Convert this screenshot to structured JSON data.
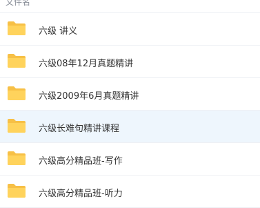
{
  "header": {
    "column_label": "文件名"
  },
  "files": [
    {
      "name": "六级 讲义",
      "icon": "folder-icon",
      "hovered": false
    },
    {
      "name": "六级08年12月真题精讲",
      "icon": "folder-icon",
      "hovered": false
    },
    {
      "name": "六级2009年6月真题精讲",
      "icon": "folder-icon",
      "hovered": false
    },
    {
      "name": "六级长难句精讲课程",
      "icon": "folder-icon",
      "hovered": true
    },
    {
      "name": "六级高分精品班-写作",
      "icon": "folder-icon",
      "hovered": false
    },
    {
      "name": "六级高分精品班-听力",
      "icon": "folder-icon",
      "hovered": false
    }
  ],
  "colors": {
    "folder": "#ffd35c",
    "folder_tab": "#f7c046",
    "hover_bg": "#eef6fd"
  }
}
